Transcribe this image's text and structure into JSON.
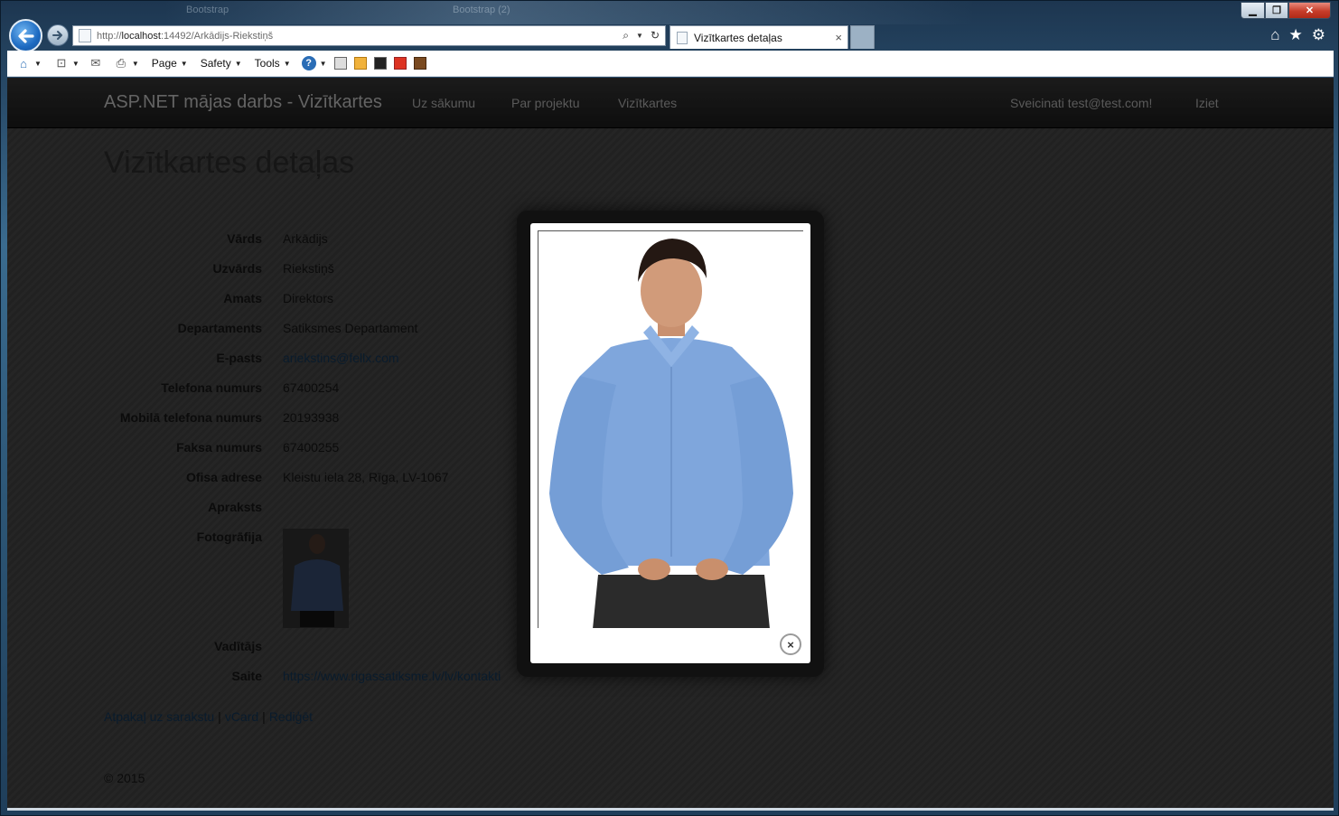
{
  "browser": {
    "ghost_titles": [
      "Bootstrap",
      "Bootstrap (2)"
    ],
    "address": {
      "prefix": "http://",
      "host": "localhost",
      "rest": ":14492/Arkādijs-Riekstiņš"
    },
    "tab": {
      "title": "Vizītkartes detaļas"
    },
    "window_controls": {
      "minimize": "▁",
      "maximize": "❐",
      "close": "✕"
    },
    "commands": {
      "page": "Page",
      "safety": "Safety",
      "tools": "Tools"
    }
  },
  "site": {
    "brand": "ASP.NET mājas darbs - Vizītkartes",
    "nav": [
      "Uz sākumu",
      "Par projektu",
      "Vizītkartes"
    ],
    "greeting": "Sveicinati test@test.com!",
    "logout": "Iziet"
  },
  "page": {
    "heading": "Vizītkartes detaļas",
    "fields": [
      {
        "label": "Vārds",
        "value": "Arkādijs"
      },
      {
        "label": "Uzvārds",
        "value": "Riekstiņš"
      },
      {
        "label": "Amats",
        "value": "Direktors"
      },
      {
        "label": "Departaments",
        "value": "Satiksmes Departament"
      },
      {
        "label": "E-pasts",
        "value": "ariekstins@fellx.com"
      },
      {
        "label": "Telefona numurs",
        "value": "67400254"
      },
      {
        "label": "Mobilā telefona numurs",
        "value": "20193938"
      },
      {
        "label": "Faksa numurs",
        "value": "67400255"
      },
      {
        "label": "Ofisa adrese",
        "value": "Kleistu iela 28, Rīga, LV-1067"
      },
      {
        "label": "Apraksts",
        "value": ""
      },
      {
        "label": "Fotogrāfija",
        "value": ""
      },
      {
        "label": "Vadītājs",
        "value": ""
      },
      {
        "label": "Saite",
        "value": "https://www.rigassatiksme.lv/lv/kontakti"
      }
    ],
    "actions": {
      "back": "Atpakaļ uz sarakstu",
      "vcard": "vCard",
      "edit": "Rediģēt",
      "separator": "|"
    },
    "footer": "© 2015"
  },
  "lightbox": {
    "close": "×"
  }
}
